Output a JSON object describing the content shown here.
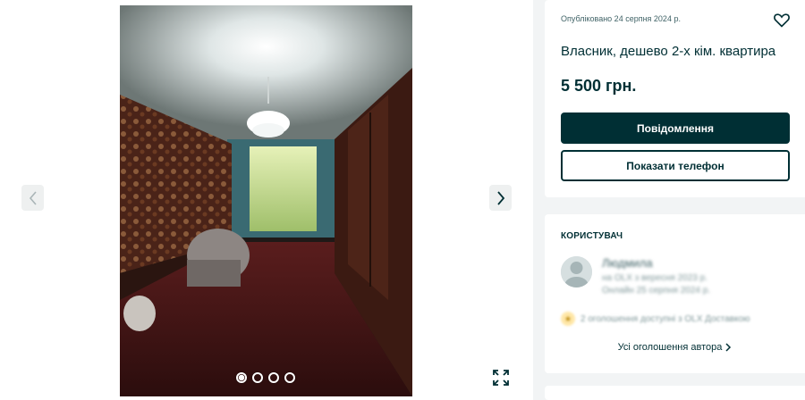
{
  "listing": {
    "published": "Опубліковано 24 серпня 2024 р.",
    "title": "Власник, дешево 2-х кім. квартира",
    "price": "5 500 грн.",
    "message_button": "Повідомлення",
    "phone_button": "Показати телефон"
  },
  "gallery": {
    "photo_count": 4,
    "active_photo": 1
  },
  "seller": {
    "section_label": "КОРИСТУВАЧ",
    "name": "Людмила",
    "registered": "на OLX з вересня 2023 р.",
    "last_seen": "Онлайн 25 серпня 2024 р.",
    "delivery": "2 оголошення доступні з OLX Доставкою",
    "all_ads": "Усі оголошення автора"
  },
  "icons": {
    "prev": "chevron-left-icon",
    "next": "chevron-right-icon",
    "favorite": "heart-icon",
    "fullscreen": "expand-icon",
    "all_ads_arrow": "chevron-right-icon"
  },
  "colors": {
    "primary": "#002f34",
    "background": "#f2f4f5",
    "card": "#ffffff"
  }
}
